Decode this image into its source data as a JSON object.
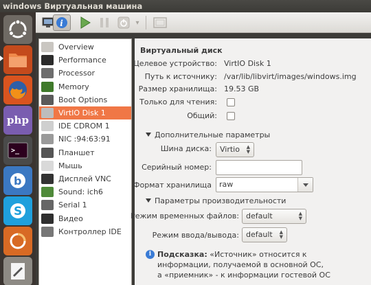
{
  "window": {
    "title": "windows Виртуальная машина"
  },
  "toolbar": {
    "dropdown_glyph": "▾"
  },
  "sidebar": {
    "items": [
      {
        "label": "Overview",
        "icon": "overview-icon"
      },
      {
        "label": "Performance",
        "icon": "performance-icon"
      },
      {
        "label": "Processor",
        "icon": "processor-icon"
      },
      {
        "label": "Memory",
        "icon": "memory-icon"
      },
      {
        "label": "Boot Options",
        "icon": "boot-options-icon"
      },
      {
        "label": "VirtIO Disk 1",
        "icon": "disk-icon",
        "selected": true
      },
      {
        "label": "IDE CDROM 1",
        "icon": "cdrom-icon"
      },
      {
        "label": "NIC :94:63:91",
        "icon": "nic-icon"
      },
      {
        "label": "Планшет",
        "icon": "tablet-icon"
      },
      {
        "label": "Мышь",
        "icon": "mouse-icon"
      },
      {
        "label": "Дисплей VNC",
        "icon": "display-icon"
      },
      {
        "label": "Sound: ich6",
        "icon": "sound-icon"
      },
      {
        "label": "Serial 1",
        "icon": "serial-icon"
      },
      {
        "label": "Видео",
        "icon": "video-icon"
      },
      {
        "label": "Контроллер IDE",
        "icon": "controller-icon"
      }
    ]
  },
  "details": {
    "section_title": "Виртуальный диск",
    "target_device_label": "Целевое устройство:",
    "target_device_value": "VirtIO Disk 1",
    "source_path_label": "Путь к источнику:",
    "source_path_value": "/var/lib/libvirt/images/windows.img",
    "storage_size_label": "Размер хранилища:",
    "storage_size_value": "19.53 GB",
    "readonly_label": "Только для чтения:",
    "shared_label": "Общий:",
    "advanced": {
      "title": "Дополнительные параметры",
      "bus_label": "Шина диска:",
      "bus_value": "Virtio",
      "serial_label": "Серийный номер:",
      "serial_value": "",
      "format_label": "Формат хранилища",
      "format_value": "raw"
    },
    "performance": {
      "title": "Параметры производительности",
      "cache_label": "Режим временных файлов:",
      "cache_value": "default",
      "io_label": "Режим ввода/вывода:",
      "io_value": "default"
    },
    "hint": {
      "icon": "info-icon",
      "bold": "Подсказка:",
      "line1": " «Источник» относится к",
      "line2": "информации, получаемой в основной ОС,",
      "line3": "а «приемник» - к информации гостевой ОС"
    }
  }
}
